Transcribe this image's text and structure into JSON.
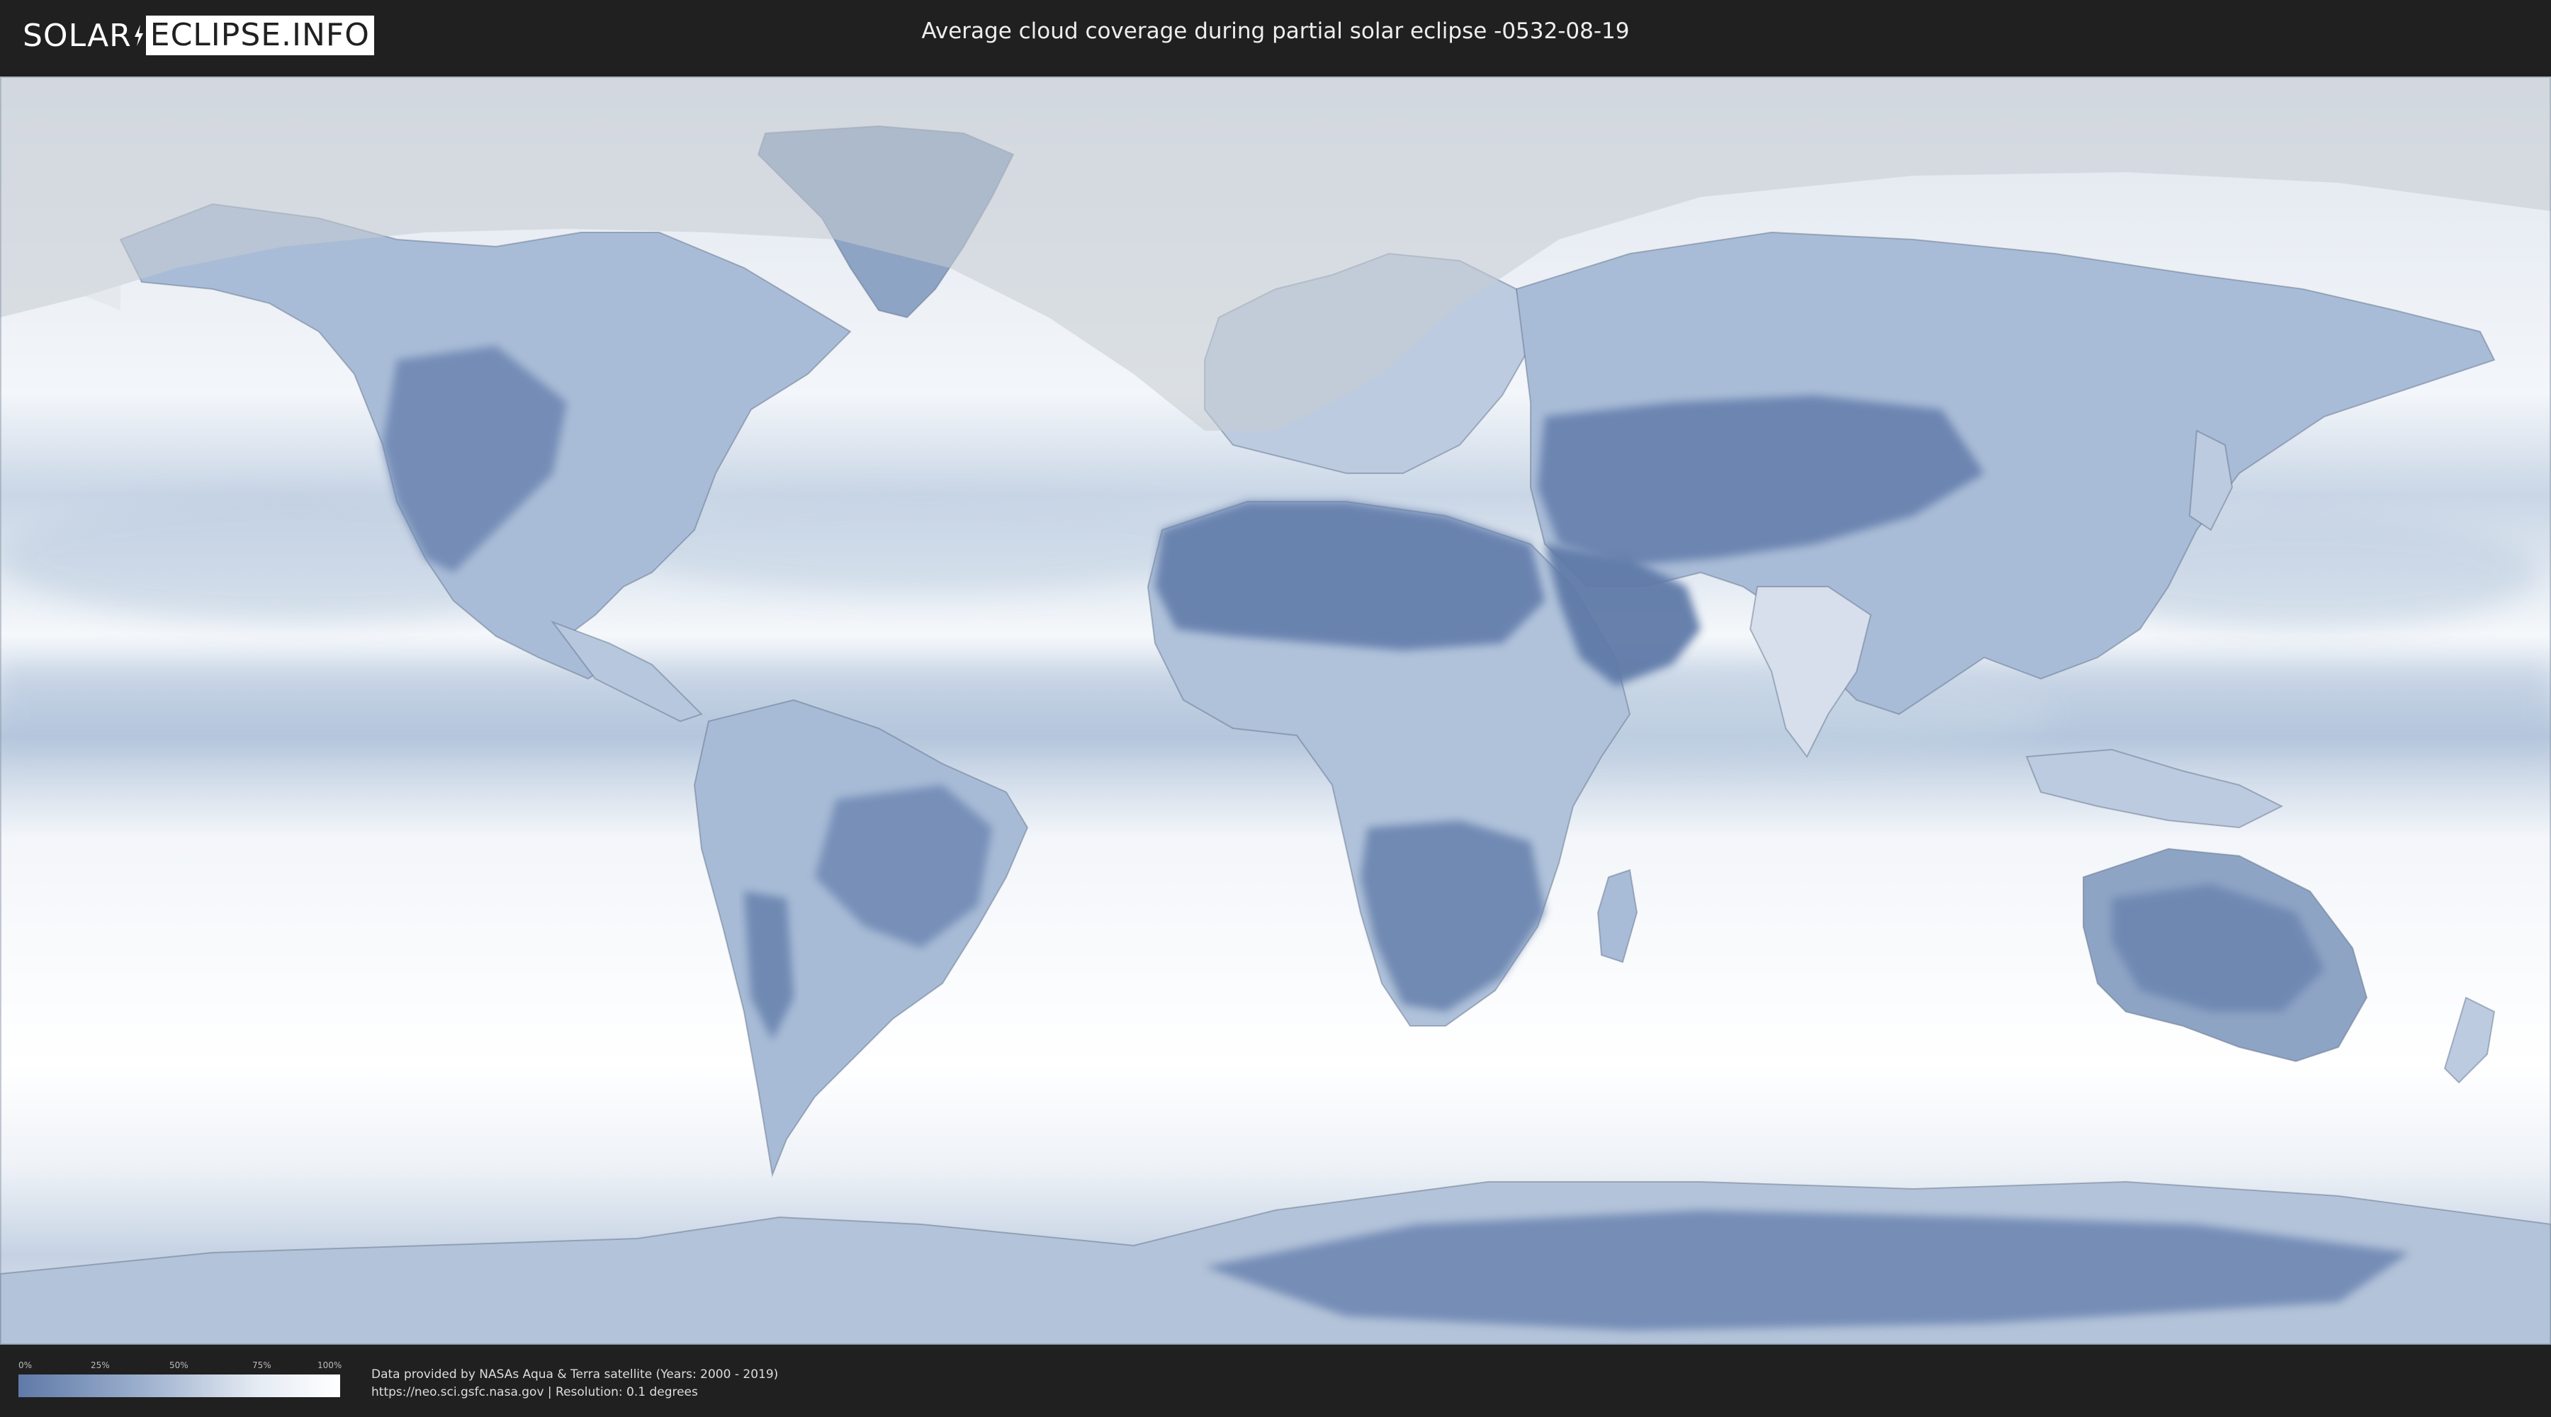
{
  "header": {
    "logo_left": "SOLAR",
    "logo_right": "ECLIPSE.INFO",
    "title": "Average cloud coverage during partial solar eclipse -0532-08-19"
  },
  "map": {
    "colors": {
      "clear": "#5f7aa8",
      "mid": "#a9bbd5",
      "cloudy": "#ffffff",
      "shade": "#c9ced4",
      "border": "#5b6b82"
    }
  },
  "legend": {
    "ticks": [
      "0%",
      "25%",
      "50%",
      "75%",
      "100%"
    ]
  },
  "credits": {
    "line1": "Data provided by NASAs Aqua & Terra satellite (Years: 2000 - 2019)",
    "line2": "https://neo.sci.gsfc.nasa.gov | Resolution: 0.1 degrees"
  }
}
